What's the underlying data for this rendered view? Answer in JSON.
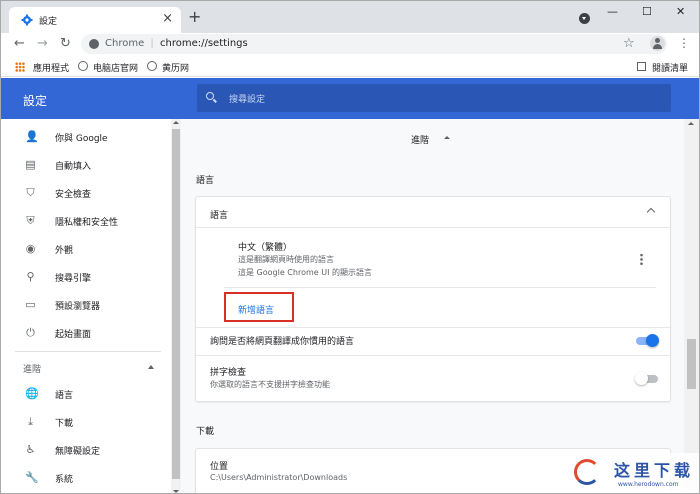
{
  "browser": {
    "tab_title": "設定",
    "tab_close": "×",
    "new_tab": "+",
    "window_controls": {
      "minimize": "—",
      "maximize": "☐",
      "close": "✕"
    },
    "nav": {
      "back": "←",
      "forward": "→",
      "reload": "↻"
    },
    "omnibox": {
      "site": "Chrome",
      "separator": "|",
      "url": "chrome://settings"
    },
    "star": "☆",
    "menu": "⋮"
  },
  "bookmarks": {
    "apps": "應用程式",
    "items": [
      "电脑店官网",
      "黄历网"
    ],
    "reading_list": "閱讀清單"
  },
  "header": {
    "title": "設定",
    "search_placeholder": "搜尋設定",
    "accent_color": "#3367d6"
  },
  "sidebar": {
    "items": [
      {
        "label": "你與 Google",
        "icon": "person-icon",
        "glyph": "👤"
      },
      {
        "label": "自動填入",
        "icon": "clipboard-icon",
        "glyph": "▤"
      },
      {
        "label": "安全檢查",
        "icon": "shield-check-icon",
        "glyph": "⛉"
      },
      {
        "label": "隱私權和安全性",
        "icon": "shield-icon",
        "glyph": "⛨"
      },
      {
        "label": "外觀",
        "icon": "palette-icon",
        "glyph": "◉"
      },
      {
        "label": "搜尋引擎",
        "icon": "search-icon",
        "glyph": "⚲"
      },
      {
        "label": "預設瀏覽器",
        "icon": "browser-icon",
        "glyph": "▭"
      },
      {
        "label": "起始畫面",
        "icon": "power-icon",
        "glyph": "⏻"
      }
    ],
    "advanced_label": "進階",
    "advanced_items": [
      {
        "label": "語言",
        "icon": "globe-icon",
        "glyph": "🌐"
      },
      {
        "label": "下載",
        "icon": "download-icon",
        "glyph": "⤓"
      },
      {
        "label": "無障礙設定",
        "icon": "accessibility-icon",
        "glyph": "♿"
      },
      {
        "label": "系統",
        "icon": "wrench-icon",
        "glyph": "🔧"
      }
    ]
  },
  "main": {
    "advanced_heading": "進階",
    "languages_title": "語言",
    "languages_card": {
      "heading": "語言",
      "language_name": "中文（繁體）",
      "desc_line1": "這是翻譯網頁時使用的語言",
      "desc_line2": "這是 Google Chrome UI 的顯示語言",
      "add_button": "新增語言",
      "translate_offer": "詢問是否將網頁翻譯成你慣用的語言",
      "translate_enabled": true,
      "spellcheck_title": "拼字檢查",
      "spellcheck_desc": "你選取的語言不支援拼字檢查功能",
      "spellcheck_enabled": false
    },
    "downloads_title": "下載",
    "downloads_card": {
      "location_label": "位置",
      "location_value": "C:\\Users\\Administrator\\Downloads"
    }
  },
  "watermark": {
    "text": "这里下载",
    "sub": "www.herodown.com"
  }
}
